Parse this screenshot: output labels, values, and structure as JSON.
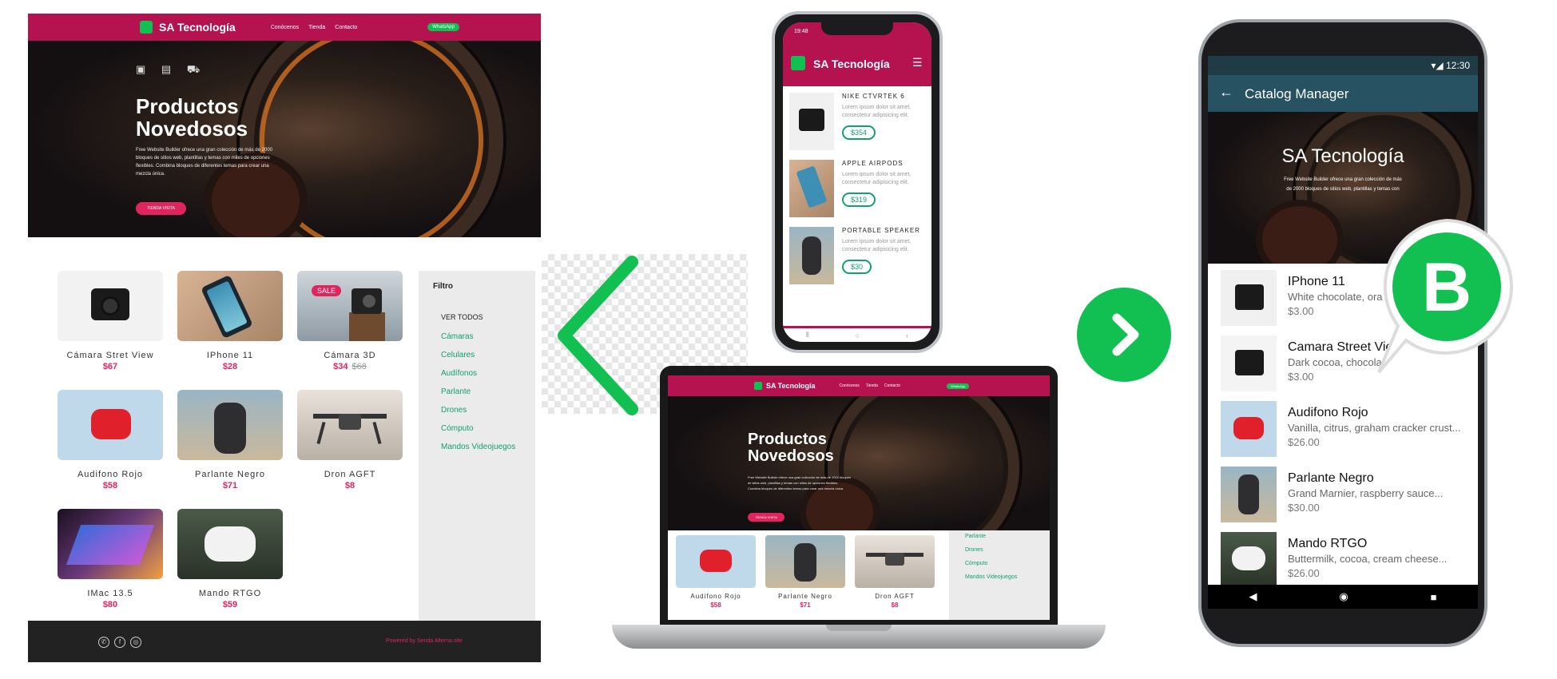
{
  "desktop": {
    "brand": "SA Tecnología",
    "nav": [
      "Conócenos",
      "Tienda",
      "Contacto"
    ],
    "nav_button": "WhatsApp",
    "hero_title_line1": "Productos",
    "hero_title_line2": "Novedosos",
    "hero_text": "Free Website Builder ofrece una gran colección de más de 2000 bloques de sitios web, plantillas y temas con miles de opciones flexibles. Combina bloques de diferentes temas para crear una mezcla única.",
    "hero_button": "TIENDA VISITA",
    "products": [
      {
        "name": "Cámara Stret View",
        "price": "$67",
        "old": ""
      },
      {
        "name": "IPhone 11",
        "price": "$28",
        "old": ""
      },
      {
        "name": "Cámara 3D",
        "price": "$34",
        "old": "$68",
        "badge": "SALE"
      },
      {
        "name": "Audifono Rojo",
        "price": "$58",
        "old": ""
      },
      {
        "name": "Parlante Negro",
        "price": "$71",
        "old": ""
      },
      {
        "name": "Dron AGFT",
        "price": "$8",
        "old": ""
      },
      {
        "name": "IMac 13.5",
        "price": "$80",
        "old": ""
      },
      {
        "name": "Mando RTGO",
        "price": "$59",
        "old": ""
      }
    ],
    "filter_title": "Filtro",
    "filter_all": "VER TODOS",
    "filters": [
      "Cámaras",
      "Celulares",
      "Audífonos",
      "Parlante",
      "Drones",
      "Cómputo",
      "Mandos Videojuegos"
    ],
    "footer_powered": "Powered by Senda Alterna.site"
  },
  "phone": {
    "time": "19:48",
    "brand": "SA Tecnología",
    "items": [
      {
        "name": "NIKE CTVRTEK 6",
        "desc": "Lorem ipsum dolor sit amet, consectetur adipisicing elit.",
        "price": "$354"
      },
      {
        "name": "APPLE AIRPODS",
        "desc": "Lorem ipsum dolor sit amet, consectetur adipisicing elit.",
        "price": "$319"
      },
      {
        "name": "PORTABLE SPEAKER",
        "desc": "Lorem ipsum dolor sit amet, consectetur adipisicing elit.",
        "price": "$30"
      }
    ]
  },
  "laptop": {
    "brand": "SA Tecnología",
    "nav": [
      "Conócenos",
      "Tienda",
      "Contacto"
    ],
    "nav_button": "WhatsApp",
    "hero_title_line1": "Productos",
    "hero_title_line2": "Novedosos",
    "hero_text": "Free Website Builder ofrece una gran colección de más de 2000 bloques de sitios web, plantillas y temas con miles de opciones flexibles. Combina bloques de diferentes temas para crear una mezcla única.",
    "hero_button": "TIENDA VISITA",
    "products": [
      {
        "name": "Audifono Rojo",
        "price": "$58"
      },
      {
        "name": "Parlante Negro",
        "price": "$71"
      },
      {
        "name": "Dron AGFT",
        "price": "$8"
      }
    ],
    "filters": [
      "Parlante",
      "Drones",
      "Cómputo",
      "Mandos Videojuegos"
    ]
  },
  "android": {
    "time": "12:30",
    "title": "Catalog Manager",
    "hero_title": "SA Tecnología",
    "hero_text_line1": "Free Website Builder ofrece una gran colección de más",
    "hero_text_line2": "de 2000 bloques de sitios web, plantillas y temas con",
    "items": [
      {
        "name": "IPhone 11",
        "desc": "White chocolate, ora",
        "price": "$3.00"
      },
      {
        "name": "Camara Street Vie",
        "desc": "Dark cocoa, chocolat",
        "price": "$3.00"
      },
      {
        "name": "Audifono Rojo",
        "desc": "Vanilla, citrus, graham cracker crust...",
        "price": "$26.00"
      },
      {
        "name": "Parlante Negro",
        "desc": "Grand Marnier, raspberry sauce...",
        "price": "$30.00"
      },
      {
        "name": "Mando RTGO",
        "desc": "Buttermilk, cocoa, cream cheese...",
        "price": "$26.00"
      }
    ],
    "badge_letter": "B"
  },
  "colors": {
    "brand": "#b5134f",
    "green": "#12c051",
    "accent": "#e0245e",
    "teal": "#12a06c"
  },
  "icons": [
    "store-icon",
    "devices-icon",
    "cart-icon",
    "whatsapp-icon",
    "facebook-icon",
    "instagram-icon",
    "back-arrow-icon",
    "menu-icon",
    "chevron-left-icon",
    "chevron-right-icon"
  ]
}
